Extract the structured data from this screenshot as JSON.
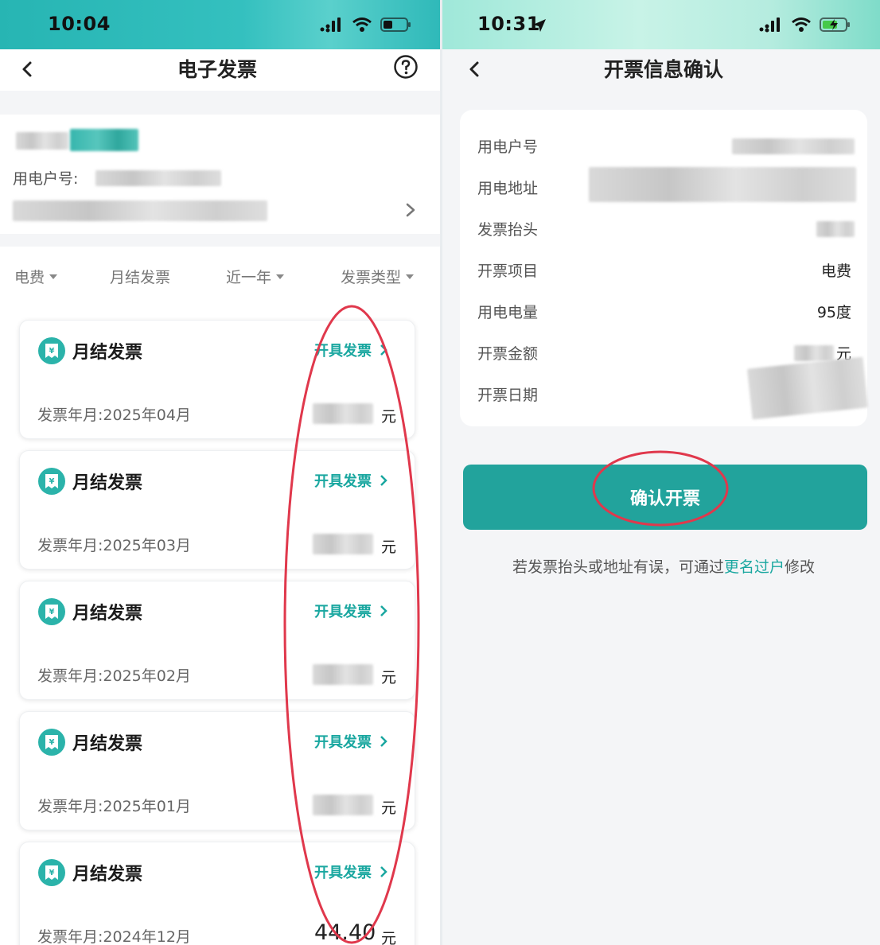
{
  "colors": {
    "brand": "#22a39c",
    "link": "#1aa7a0",
    "annotation": "#e0384c"
  },
  "left": {
    "status": {
      "time": "10:04"
    },
    "nav": {
      "title": "电子发票",
      "back_icon": "chevron-left-icon",
      "help_icon": "question-circle-icon"
    },
    "account": {
      "user_no_label": "用电户号:"
    },
    "filters": [
      {
        "label": "电费",
        "has_caret": true
      },
      {
        "label": "月结发票",
        "has_caret": false
      },
      {
        "label": "近一年",
        "has_caret": true
      },
      {
        "label": "发票类型",
        "has_caret": true
      }
    ],
    "invoices": [
      {
        "title": "月结发票",
        "action": "开具发票",
        "date": "发票年月:2025年04月",
        "amount": "",
        "unit": "元"
      },
      {
        "title": "月结发票",
        "action": "开具发票",
        "date": "发票年月:2025年03月",
        "amount": "",
        "unit": "元"
      },
      {
        "title": "月结发票",
        "action": "开具发票",
        "date": "发票年月:2025年02月",
        "amount": "",
        "unit": "元"
      },
      {
        "title": "月结发票",
        "action": "开具发票",
        "date": "发票年月:2025年01月",
        "amount": "",
        "unit": "元"
      },
      {
        "title": "月结发票",
        "action": "开具发票",
        "date": "发票年月:2024年12月",
        "amount": "44.40",
        "unit": "元"
      }
    ]
  },
  "right": {
    "status": {
      "time": "10:31"
    },
    "nav": {
      "title": "开票信息确认",
      "back_icon": "chevron-left-icon"
    },
    "info": [
      {
        "label": "用电户号",
        "value": ""
      },
      {
        "label": "用电地址",
        "value": ""
      },
      {
        "label": "发票抬头",
        "value": ""
      },
      {
        "label": "开票项目",
        "value": "电费"
      },
      {
        "label": "用电电量",
        "value": "95度"
      },
      {
        "label": "开票金额",
        "value": "元"
      },
      {
        "label": "开票日期",
        "value": ""
      }
    ],
    "confirm_label": "确认开票",
    "note_prefix": "若发票抬头或地址有误，可通过",
    "note_link": "更名过户",
    "note_suffix": "修改"
  }
}
